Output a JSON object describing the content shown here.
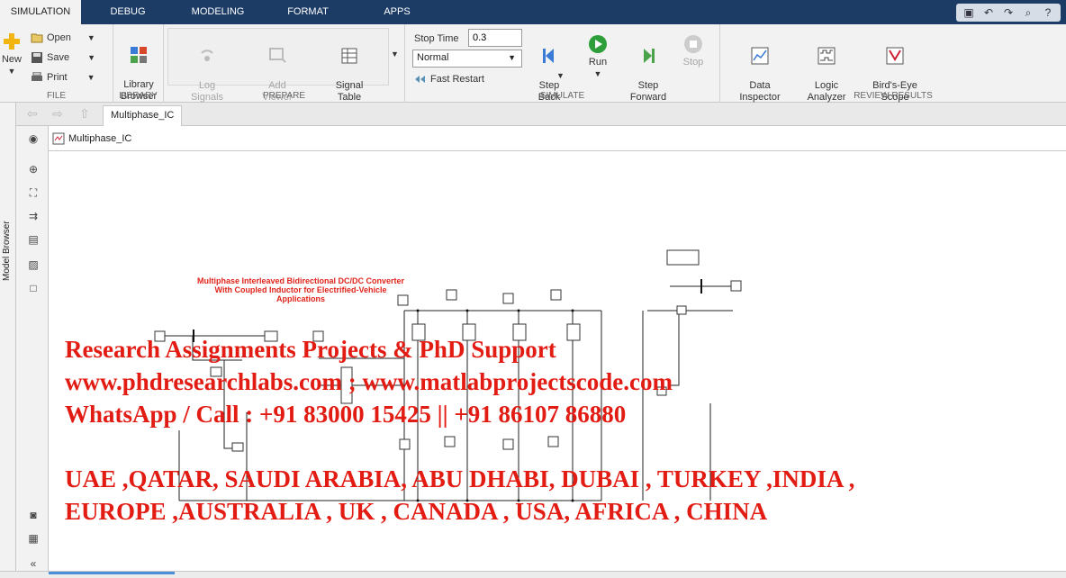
{
  "tabs": [
    {
      "label": "SIMULATION",
      "active": true
    },
    {
      "label": "DEBUG"
    },
    {
      "label": "MODELING"
    },
    {
      "label": "FORMAT"
    },
    {
      "label": "APPS"
    }
  ],
  "ribbon": {
    "file": {
      "title": "FILE",
      "new_label": "New",
      "open_label": "Open",
      "save_label": "Save",
      "print_label": "Print"
    },
    "library": {
      "title": "LIBRARY",
      "browser_label": "Library\nBrowser"
    },
    "prepare": {
      "title": "PREPARE",
      "log_signals_label": "Log\nSignals",
      "add_viewer_label": "Add\nViewer",
      "signal_table_label": "Signal\nTable"
    },
    "simulate": {
      "title": "SIMULATE",
      "stop_time_label": "Stop Time",
      "stop_time_value": "0.3",
      "mode_value": "Normal",
      "fast_restart_label": "Fast Restart",
      "step_back_label": "Step\nBack",
      "run_label": "Run",
      "step_forward_label": "Step\nForward",
      "stop_label": "Stop"
    },
    "review": {
      "title": "REVIEW RESULTS",
      "data_inspector_label": "Data\nInspector",
      "logic_analyzer_label": "Logic\nAnalyzer",
      "birds_eye_label": "Bird's-Eye\nScope"
    }
  },
  "model_tab": "Multiphase_IC",
  "breadcrumb": "Multiphase_IC",
  "model_browser_label": "Model Browser",
  "model_title": [
    "Multiphase Interleaved Bidirectional DC/DC Converter",
    "With Coupled Inductor for Electrified-Vehicle",
    "Applications"
  ],
  "watermark": [
    "Research Assignments Projects & PhD Support",
    "www.phdresearchlabs.com ; www.matlabprojectscode.com",
    "WhatsApp / Call : +91 83000 15425 || +91 86107 86880",
    "",
    "UAE ,QATAR, SAUDI ARABIA, ABU DHABI, DUBAI , TURKEY ,INDIA ,",
    "EUROPE ,AUSTRALIA , UK , CANADA , USA, AFRICA , CHINA"
  ],
  "colors": {
    "tabstrip": "#1c3c66",
    "ribbon": "#f2f2f2",
    "watermark": "#e21b13",
    "run_green": "#2e9e3a",
    "step_blue": "#3a7bd5"
  },
  "icons": {
    "new": "plus-icon",
    "open": "folder-icon",
    "save": "floppy-icon",
    "print": "printer-icon",
    "library": "grid-icon",
    "run": "play-icon",
    "stop": "stop-icon"
  }
}
